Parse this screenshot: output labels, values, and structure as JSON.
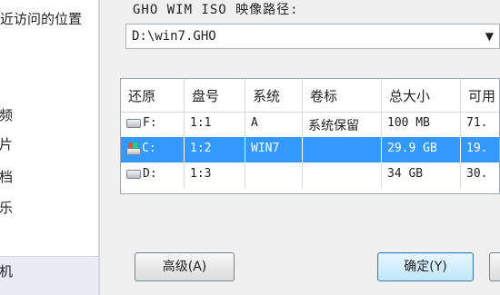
{
  "left_panel": {
    "recent": "近访问的位置",
    "videos": "视频",
    "pictures": "图片",
    "documents": "文档",
    "music": "音乐",
    "computer": "算机"
  },
  "dialog": {
    "path_label": "GHO WIM ISO 映像路径:",
    "path_value": "D:\\win7.GHO",
    "dropdown_icon": "dropdown-arrow-icon",
    "table": {
      "headers": [
        "还原",
        "盘号",
        "系统",
        "卷标",
        "总大小",
        "可用"
      ],
      "rows": [
        [
          "F:",
          "1:1",
          "A",
          "系统保留",
          "100 MB",
          "71."
        ],
        [
          "C:",
          "1:2",
          "WIN7",
          "",
          "29.9 GB",
          "19."
        ],
        [
          "D:",
          "1:3",
          "",
          "",
          "34 GB",
          "30."
        ]
      ],
      "selected_row": 1
    },
    "advanced_button": "高级(A)",
    "ok_button": "确定(Y)"
  },
  "colors": {
    "selection": "#3399ff",
    "dialog_bg": "#f0f0f0"
  }
}
